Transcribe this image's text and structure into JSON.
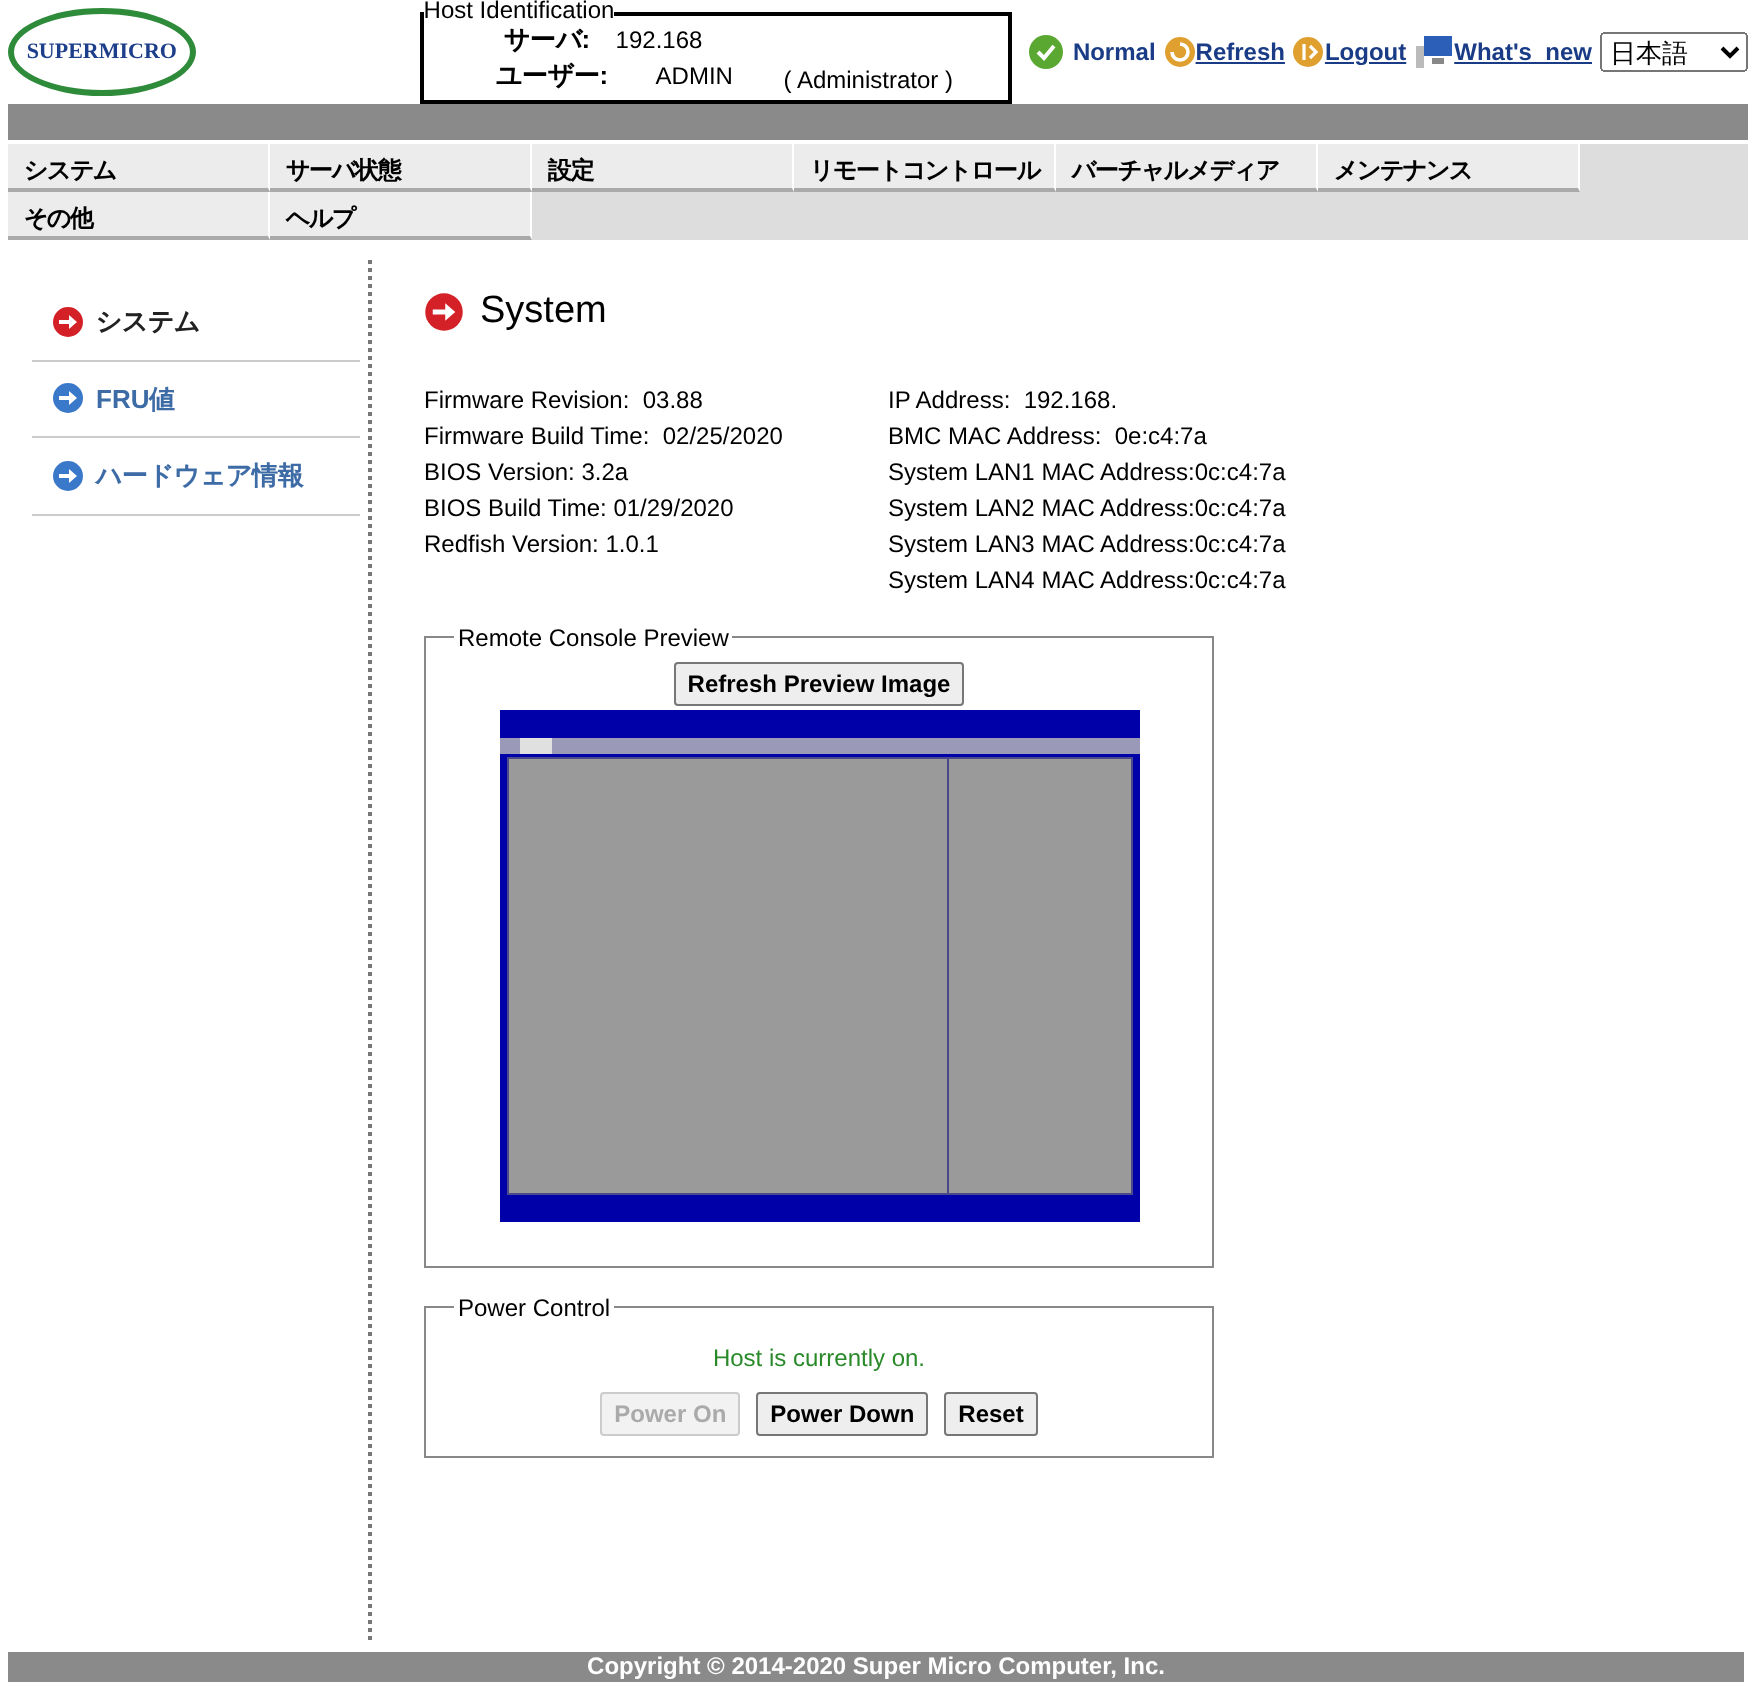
{
  "logo": {
    "text": "SUPERMICRO"
  },
  "host_identification": {
    "legend": "Host Identification",
    "server_label": "サーバ:",
    "server_value": "192.168",
    "user_label": "ユーザー:",
    "user_value": "ADMIN",
    "user_role": "( Administrator )"
  },
  "header_links": [
    {
      "kind": "status",
      "label": "Normal"
    },
    {
      "kind": "refresh",
      "label": "Refresh"
    },
    {
      "kind": "logout",
      "label": "Logout"
    },
    {
      "kind": "whatsnew",
      "label": "What's_new"
    }
  ],
  "language_select": {
    "value": "日本語"
  },
  "menu": [
    {
      "label": "システム"
    },
    {
      "label": "サーバ状態"
    },
    {
      "label": "設定"
    },
    {
      "label": "リモートコントロール"
    },
    {
      "label": "バーチャルメディア"
    },
    {
      "label": "メンテナンス"
    },
    {
      "label": "その他"
    },
    {
      "label": "ヘルプ"
    }
  ],
  "sidebar": {
    "items": [
      {
        "label": "システム",
        "selected": true
      },
      {
        "label": "FRU値",
        "selected": false
      },
      {
        "label": "ハードウェア情報",
        "selected": false
      }
    ]
  },
  "page_title": "System",
  "info_left": [
    "Firmware Revision:  03.88",
    "Firmware Build Time:  02/25/2020",
    "BIOS Version: 3.2a",
    "BIOS Build Time: 01/29/2020",
    "Redfish Version: 1.0.1"
  ],
  "info_right": [
    "IP Address:  192.168.",
    "BMC MAC Address:  0e:c4:7a",
    "System LAN1 MAC Address:0c:c4:7a",
    "System LAN2 MAC Address:0c:c4:7a",
    "System LAN3 MAC Address:0c:c4:7a",
    "System LAN4 MAC Address:0c:c4:7a"
  ],
  "remote_console": {
    "legend": "Remote Console Preview",
    "button": "Refresh Preview Image"
  },
  "power_control": {
    "legend": "Power Control",
    "status": "Host is currently on.",
    "buttons": [
      {
        "label": "Power On",
        "disabled": true
      },
      {
        "label": "Power Down",
        "disabled": false
      },
      {
        "label": "Reset",
        "disabled": false
      }
    ]
  },
  "footer": "Copyright © 2014-2020 Super Micro Computer, Inc."
}
